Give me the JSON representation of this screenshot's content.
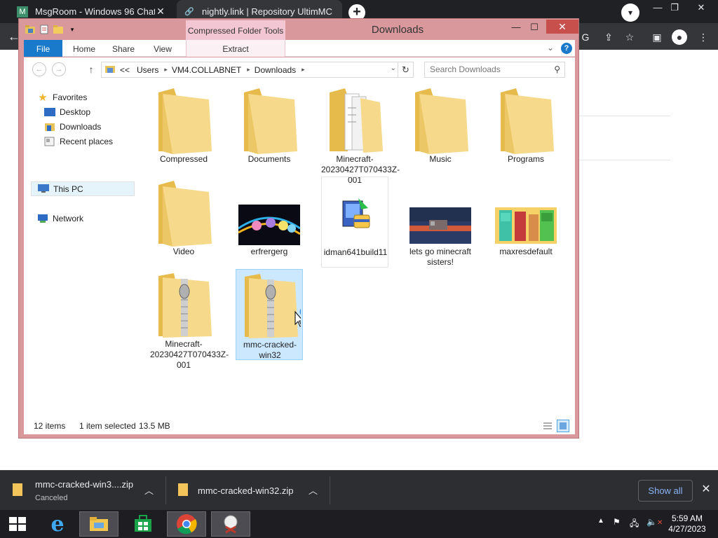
{
  "browser": {
    "tabs": [
      {
        "title": "MsgRoom - Windows 96 Chat",
        "active": false
      },
      {
        "title": "nightly.link | Repository UltimMC",
        "active": true
      }
    ],
    "new_tab_label": "+"
  },
  "explorer": {
    "window_title": "Downloads",
    "context_tools": "Compressed Folder Tools",
    "ribbon_tabs": [
      "File",
      "Home",
      "Share",
      "View"
    ],
    "context_tab": "Extract",
    "address": {
      "overflow": "<<",
      "crumbs": [
        "Users",
        "VM4.COLLABNET",
        "Downloads"
      ]
    },
    "search_placeholder": "Search Downloads",
    "nav_pane": {
      "favorites_label": "Favorites",
      "favorites": [
        "Desktop",
        "Downloads",
        "Recent places"
      ],
      "this_pc": "This PC",
      "network": "Network"
    },
    "items": [
      {
        "name": "Compressed",
        "type": "folder"
      },
      {
        "name": "Documents",
        "type": "folder"
      },
      {
        "name": "Minecraft-20230427T070433Z-001",
        "type": "folder-docs"
      },
      {
        "name": "Music",
        "type": "folder"
      },
      {
        "name": "Programs",
        "type": "folder"
      },
      {
        "name": "Video",
        "type": "folder"
      },
      {
        "name": "erfrergerg",
        "type": "image-ponies"
      },
      {
        "name": "idman641build11",
        "type": "installer"
      },
      {
        "name": "lets go minecraft sisters!",
        "type": "image-game"
      },
      {
        "name": "maxresdefault",
        "type": "image-minecraft"
      },
      {
        "name": "Minecraft-20230427T070433Z-001",
        "type": "zip"
      },
      {
        "name": "mmc-cracked-win32",
        "type": "zip",
        "selected": true
      }
    ],
    "status": {
      "count": "12 items",
      "selection": "1 item selected",
      "size": "13.5 MB"
    }
  },
  "downloads": [
    {
      "name": "mmc-cracked-win3....zip",
      "status": "Canceled"
    },
    {
      "name": "mmc-cracked-win32.zip",
      "status": ""
    }
  ],
  "show_all": "Show all",
  "clock": {
    "time": "5:59 AM",
    "date": "4/27/2023"
  },
  "colors": {
    "window_frame": "#d8989c",
    "file_tab": "#1979ca",
    "selection": "#cce8ff",
    "close_button": "#c7504d",
    "chrome_dark": "#202124",
    "download_link": "#8ab4f8"
  }
}
